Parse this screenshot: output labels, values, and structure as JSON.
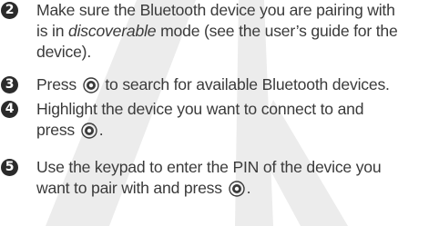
{
  "steps": [
    {
      "number": "2",
      "line1": "Make sure the Bluetooth device you are pairing with",
      "line2_before": "is in ",
      "line2_italic": "discoverable",
      "line2_after": " mode (see the user’s guide for the",
      "line3": "device)."
    },
    {
      "number": "3",
      "before": "Press ",
      "after": " to search for available Bluetooth devices."
    },
    {
      "number": "4",
      "line1": "Highlight the device you want to connect to and",
      "line2_before": "press ",
      "line2_after": "."
    },
    {
      "number": "5",
      "line1": "Use the keypad to enter the PIN of the device you",
      "line2_before": "want to pair with and press ",
      "line2_after": "."
    }
  ],
  "icons": {
    "select_key": "center-select-key-icon",
    "watermark": "draft-watermark"
  },
  "colors": {
    "text": "#3a3a3a",
    "badge": "#2b2b2b",
    "watermark": "#e6e6e6"
  }
}
